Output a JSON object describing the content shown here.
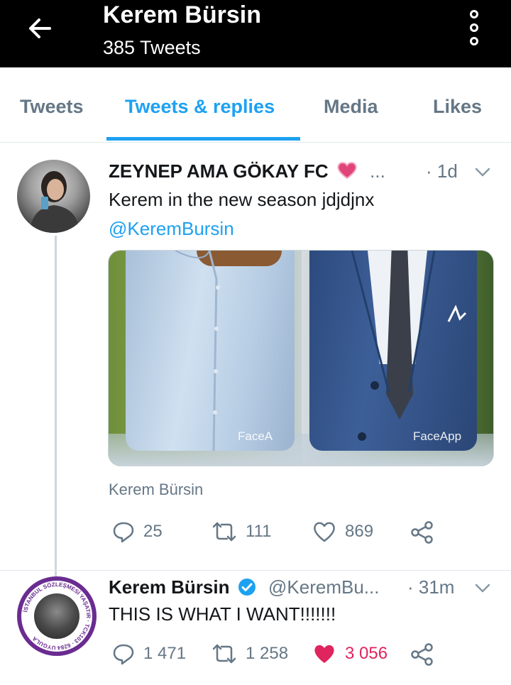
{
  "header": {
    "title": "Kerem Bürsin",
    "subtitle": "385 Tweets"
  },
  "tabs": [
    {
      "label": "Tweets",
      "active": false
    },
    {
      "label": "Tweets & replies",
      "active": true
    },
    {
      "label": "Media",
      "active": false
    },
    {
      "label": "Likes",
      "active": false
    }
  ],
  "tweets": [
    {
      "name": "ZEYNEP AMA GÖKAY FC",
      "name_suffix": "...",
      "handle": "",
      "time": "· 1d",
      "text": "Kerem in the new season jdjdjnx",
      "mention": "@KeremBursin",
      "media_watermarks": [
        "FaceA",
        "FaceApp"
      ],
      "attribution": "Kerem Bürsin",
      "replies": "25",
      "retweets": "111",
      "likes": "869",
      "liked": false
    },
    {
      "name": "Kerem Bürsin",
      "handle": "@KeremBu...",
      "time": "· 31m",
      "verified": true,
      "text": "THIS IS WHAT I WANT!!!!!!!",
      "avatar_ring_text": "İSTANBUL SÖZLEŞMESİ YAŞATIR · TCK103 · 6284 UYGULA",
      "replies": "1 471",
      "retweets": "1 258",
      "likes": "3 056",
      "liked": true
    }
  ],
  "colors": {
    "accent": "#1da1f2",
    "muted": "#657786",
    "like": "#e0245e",
    "header_bg": "#000000",
    "avatar_ring": "#6a2c91"
  }
}
